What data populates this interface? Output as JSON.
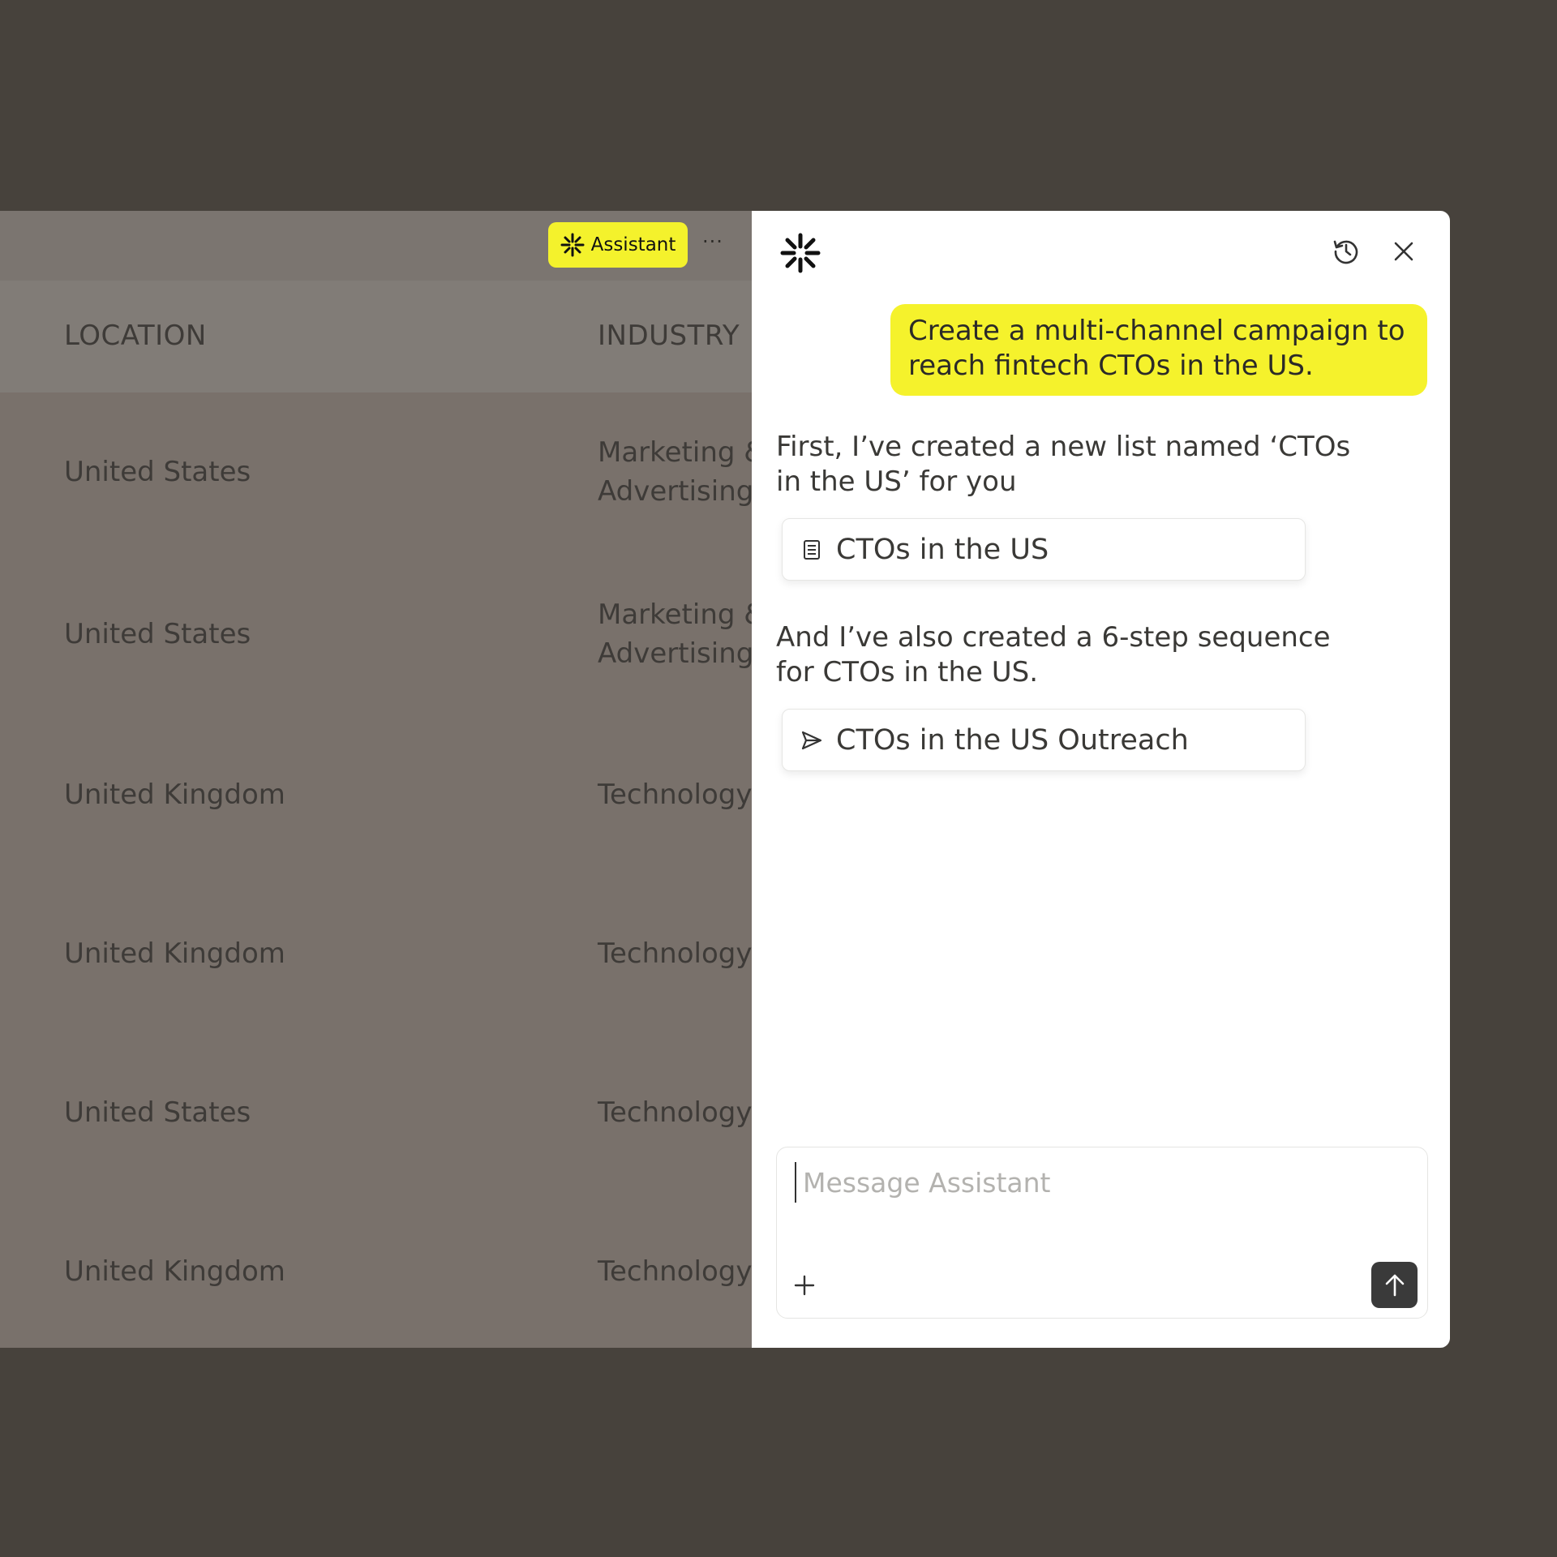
{
  "toolbar": {
    "assistant_label": "Assistant",
    "more_label": "···"
  },
  "table": {
    "columns": [
      "LOCATION",
      "INDUSTRY"
    ],
    "rows": [
      {
        "location": "United States",
        "industry": "Marketing &\nAdvertising"
      },
      {
        "location": "United States",
        "industry": "Marketing &\nAdvertising"
      },
      {
        "location": "United Kingdom",
        "industry": "Technology,"
      },
      {
        "location": "United Kingdom",
        "industry": "Technology,"
      },
      {
        "location": "United States",
        "industry": "Technology,"
      },
      {
        "location": "United Kingdom",
        "industry": "Technology,"
      }
    ]
  },
  "assistant_panel": {
    "user_message": "Create a multi-channel campaign to reach fintech CTOs in the US.",
    "reply_1": "First, I’ve created a new list named ‘CTOs in the US’ for you",
    "list_chip": "CTOs in the US",
    "reply_2": "And I’ve also created a 6-step sequence for CTOs in the US.",
    "sequence_chip": "CTOs in the US Outreach",
    "composer_placeholder": "Message Assistant"
  },
  "colors": {
    "accent_yellow": "#f5f22c",
    "page_bg": "#47423c",
    "overlay_bg": "#79716b",
    "send_button": "#3a3a3a"
  }
}
